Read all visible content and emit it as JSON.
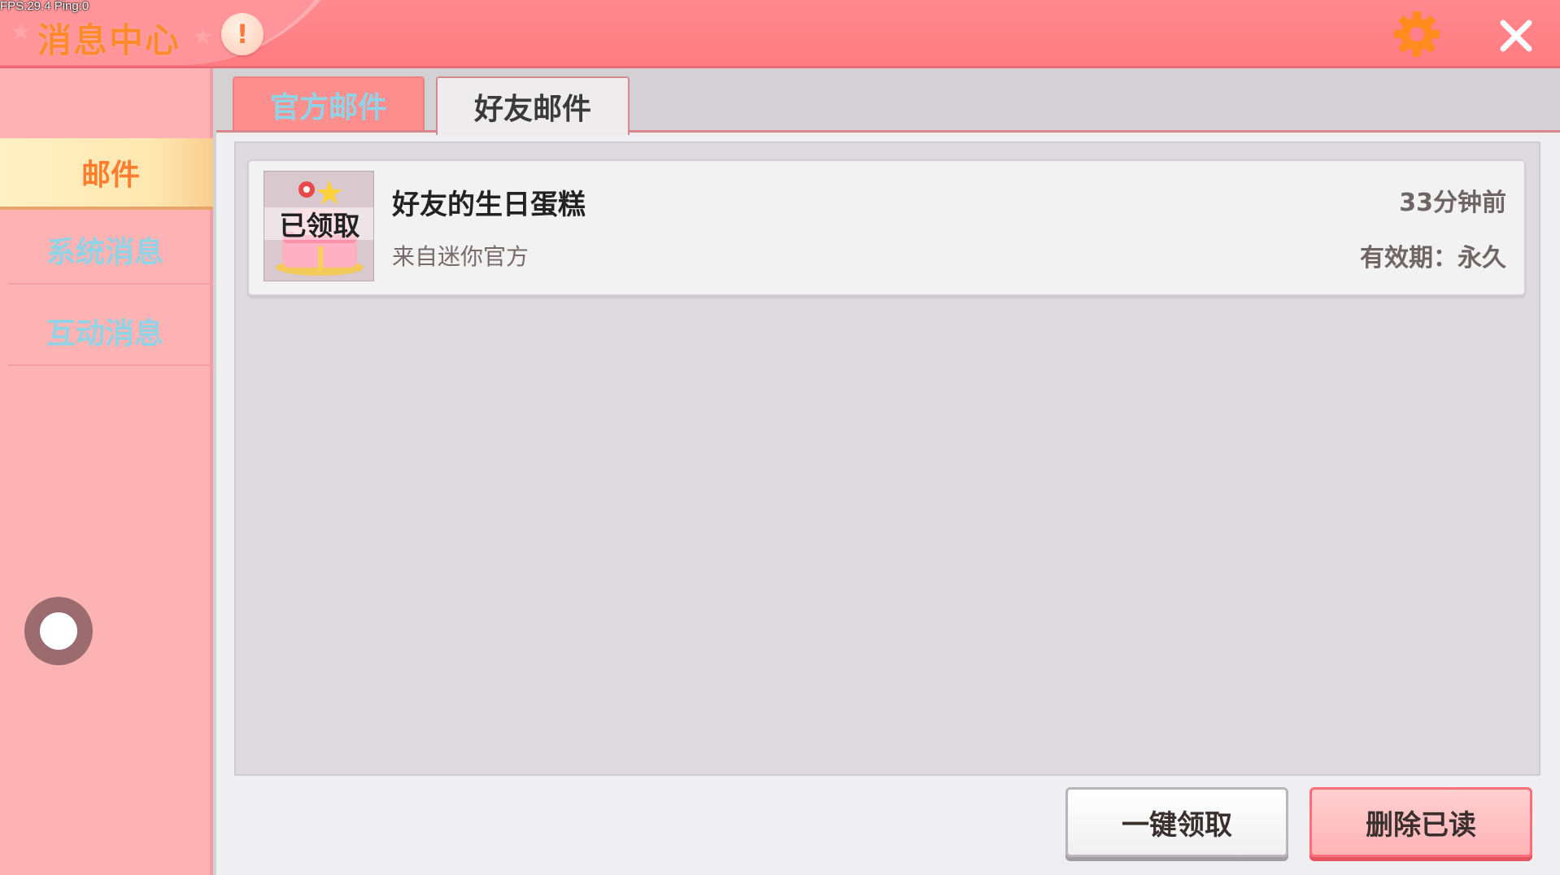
{
  "debug": {
    "fps_text": "FPS:29.4  Ping:0"
  },
  "header": {
    "title": "消息中心",
    "notice_glyph": "!",
    "settings_icon": "gear-icon",
    "close_icon": "close-icon"
  },
  "sidebar": {
    "items": [
      {
        "label": "邮件",
        "active": true
      },
      {
        "label": "系统消息",
        "active": false
      },
      {
        "label": "互动消息",
        "active": false
      }
    ]
  },
  "tabs": [
    {
      "label": "官方邮件",
      "active": false
    },
    {
      "label": "好友邮件",
      "active": true
    }
  ],
  "mails": [
    {
      "title": "好友的生日蛋糕",
      "from": "来自迷你官方",
      "time": "33分钟前",
      "validity": "有效期：永久",
      "badge": "已领取"
    }
  ],
  "actions": {
    "claim_all": "一键领取",
    "delete_read": "删除已读"
  },
  "colors": {
    "header": "#ff8088",
    "sidebar": "#fdb3b4",
    "accent_orange": "#ff7d2c",
    "inactive_text": "#8fd3e6"
  }
}
